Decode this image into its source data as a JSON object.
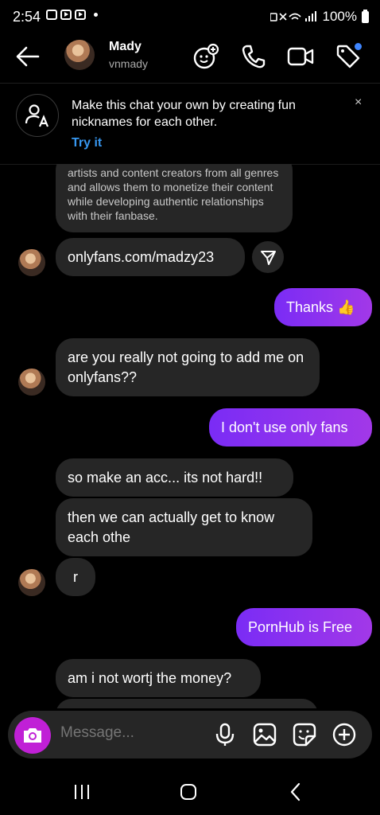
{
  "status": {
    "time": "2:54",
    "battery": "100%"
  },
  "header": {
    "name": "Mady",
    "username": "vnmady"
  },
  "banner": {
    "text": "Make this chat your own by creating fun nicknames for each other.",
    "action": "Try it",
    "close": "×"
  },
  "messages": [
    {
      "from": "them",
      "text": "artists and content creators from all genres and allows them to monetize their content while developing authentic relationships with their fanbase."
    },
    {
      "from": "them",
      "text": "onlyfans.com/madzy23"
    },
    {
      "from": "me",
      "text": "Thanks 👍"
    },
    {
      "from": "them",
      "text": "are you really not going to add me on onlyfans??"
    },
    {
      "from": "me",
      "text": "I don't use only fans"
    },
    {
      "from": "them",
      "text": "so make an acc... its not hard!!"
    },
    {
      "from": "them",
      "text": "then we can actually get to know each othe"
    },
    {
      "from": "them",
      "text": "r"
    },
    {
      "from": "me",
      "text": "PornHub is Free"
    },
    {
      "from": "them",
      "text": "am i not wortj the money?"
    }
  ],
  "composer": {
    "placeholder": "Message..."
  },
  "colors": {
    "accent_out": "#8b32f0",
    "bubble_in": "#262626",
    "link": "#3797f0",
    "camera": "#c020d6"
  },
  "icons": [
    "back-arrow-icon",
    "add-effect-icon",
    "phone-icon",
    "video-camera-icon",
    "tag-icon",
    "nickname-icon",
    "share-icon",
    "camera-icon",
    "microphone-icon",
    "gallery-icon",
    "sticker-icon",
    "plus-icon",
    "recent-apps-icon",
    "home-icon",
    "nav-back-icon"
  ]
}
